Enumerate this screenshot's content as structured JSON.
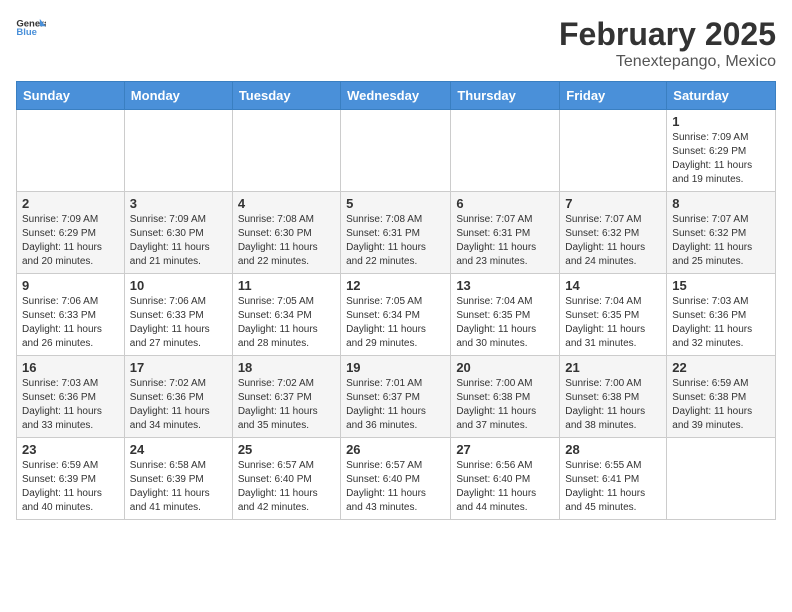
{
  "header": {
    "logo_general": "General",
    "logo_blue": "Blue",
    "month_title": "February 2025",
    "location": "Tenextepango, Mexico"
  },
  "weekdays": [
    "Sunday",
    "Monday",
    "Tuesday",
    "Wednesday",
    "Thursday",
    "Friday",
    "Saturday"
  ],
  "weeks": [
    {
      "row_alt": false,
      "days": [
        {
          "num": "",
          "info": ""
        },
        {
          "num": "",
          "info": ""
        },
        {
          "num": "",
          "info": ""
        },
        {
          "num": "",
          "info": ""
        },
        {
          "num": "",
          "info": ""
        },
        {
          "num": "",
          "info": ""
        },
        {
          "num": "1",
          "info": "Sunrise: 7:09 AM\nSunset: 6:29 PM\nDaylight: 11 hours\nand 19 minutes."
        }
      ]
    },
    {
      "row_alt": true,
      "days": [
        {
          "num": "2",
          "info": "Sunrise: 7:09 AM\nSunset: 6:29 PM\nDaylight: 11 hours\nand 20 minutes."
        },
        {
          "num": "3",
          "info": "Sunrise: 7:09 AM\nSunset: 6:30 PM\nDaylight: 11 hours\nand 21 minutes."
        },
        {
          "num": "4",
          "info": "Sunrise: 7:08 AM\nSunset: 6:30 PM\nDaylight: 11 hours\nand 22 minutes."
        },
        {
          "num": "5",
          "info": "Sunrise: 7:08 AM\nSunset: 6:31 PM\nDaylight: 11 hours\nand 22 minutes."
        },
        {
          "num": "6",
          "info": "Sunrise: 7:07 AM\nSunset: 6:31 PM\nDaylight: 11 hours\nand 23 minutes."
        },
        {
          "num": "7",
          "info": "Sunrise: 7:07 AM\nSunset: 6:32 PM\nDaylight: 11 hours\nand 24 minutes."
        },
        {
          "num": "8",
          "info": "Sunrise: 7:07 AM\nSunset: 6:32 PM\nDaylight: 11 hours\nand 25 minutes."
        }
      ]
    },
    {
      "row_alt": false,
      "days": [
        {
          "num": "9",
          "info": "Sunrise: 7:06 AM\nSunset: 6:33 PM\nDaylight: 11 hours\nand 26 minutes."
        },
        {
          "num": "10",
          "info": "Sunrise: 7:06 AM\nSunset: 6:33 PM\nDaylight: 11 hours\nand 27 minutes."
        },
        {
          "num": "11",
          "info": "Sunrise: 7:05 AM\nSunset: 6:34 PM\nDaylight: 11 hours\nand 28 minutes."
        },
        {
          "num": "12",
          "info": "Sunrise: 7:05 AM\nSunset: 6:34 PM\nDaylight: 11 hours\nand 29 minutes."
        },
        {
          "num": "13",
          "info": "Sunrise: 7:04 AM\nSunset: 6:35 PM\nDaylight: 11 hours\nand 30 minutes."
        },
        {
          "num": "14",
          "info": "Sunrise: 7:04 AM\nSunset: 6:35 PM\nDaylight: 11 hours\nand 31 minutes."
        },
        {
          "num": "15",
          "info": "Sunrise: 7:03 AM\nSunset: 6:36 PM\nDaylight: 11 hours\nand 32 minutes."
        }
      ]
    },
    {
      "row_alt": true,
      "days": [
        {
          "num": "16",
          "info": "Sunrise: 7:03 AM\nSunset: 6:36 PM\nDaylight: 11 hours\nand 33 minutes."
        },
        {
          "num": "17",
          "info": "Sunrise: 7:02 AM\nSunset: 6:36 PM\nDaylight: 11 hours\nand 34 minutes."
        },
        {
          "num": "18",
          "info": "Sunrise: 7:02 AM\nSunset: 6:37 PM\nDaylight: 11 hours\nand 35 minutes."
        },
        {
          "num": "19",
          "info": "Sunrise: 7:01 AM\nSunset: 6:37 PM\nDaylight: 11 hours\nand 36 minutes."
        },
        {
          "num": "20",
          "info": "Sunrise: 7:00 AM\nSunset: 6:38 PM\nDaylight: 11 hours\nand 37 minutes."
        },
        {
          "num": "21",
          "info": "Sunrise: 7:00 AM\nSunset: 6:38 PM\nDaylight: 11 hours\nand 38 minutes."
        },
        {
          "num": "22",
          "info": "Sunrise: 6:59 AM\nSunset: 6:38 PM\nDaylight: 11 hours\nand 39 minutes."
        }
      ]
    },
    {
      "row_alt": false,
      "days": [
        {
          "num": "23",
          "info": "Sunrise: 6:59 AM\nSunset: 6:39 PM\nDaylight: 11 hours\nand 40 minutes."
        },
        {
          "num": "24",
          "info": "Sunrise: 6:58 AM\nSunset: 6:39 PM\nDaylight: 11 hours\nand 41 minutes."
        },
        {
          "num": "25",
          "info": "Sunrise: 6:57 AM\nSunset: 6:40 PM\nDaylight: 11 hours\nand 42 minutes."
        },
        {
          "num": "26",
          "info": "Sunrise: 6:57 AM\nSunset: 6:40 PM\nDaylight: 11 hours\nand 43 minutes."
        },
        {
          "num": "27",
          "info": "Sunrise: 6:56 AM\nSunset: 6:40 PM\nDaylight: 11 hours\nand 44 minutes."
        },
        {
          "num": "28",
          "info": "Sunrise: 6:55 AM\nSunset: 6:41 PM\nDaylight: 11 hours\nand 45 minutes."
        },
        {
          "num": "",
          "info": ""
        }
      ]
    }
  ]
}
